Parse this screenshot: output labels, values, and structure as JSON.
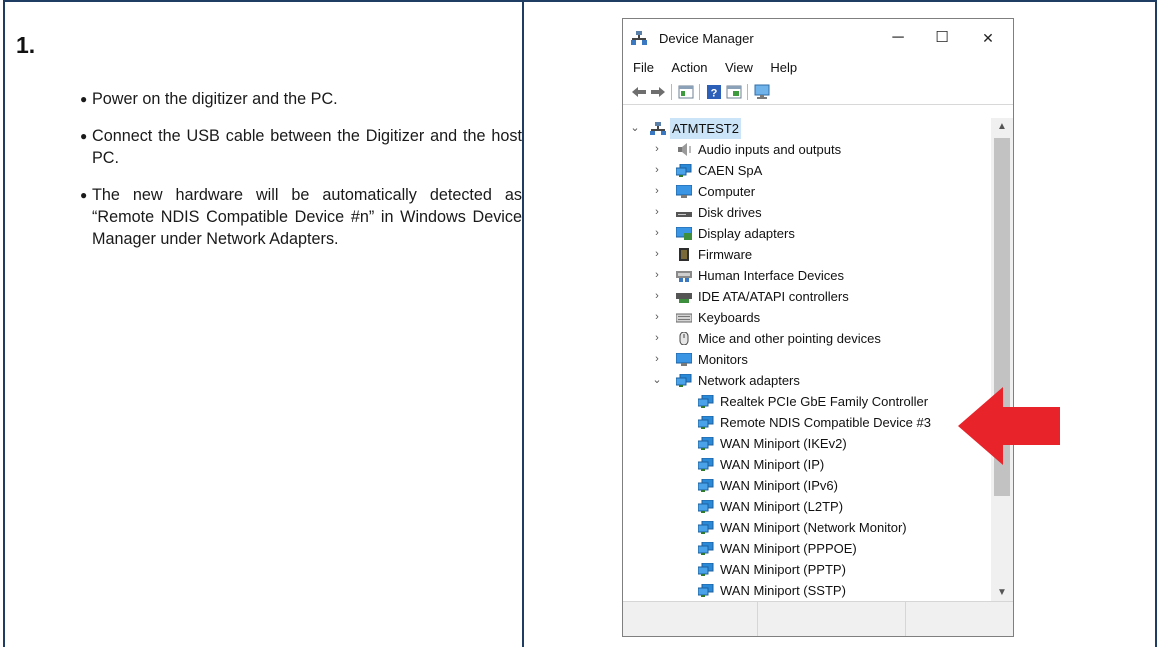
{
  "step": {
    "number": "1."
  },
  "instructions": [
    "Power on the digitizer and the PC.",
    "Connect the USB cable between the Digitizer and the host PC.",
    "The new hardware will be automatically detected as “Remote NDIS Compatible Device #n” in Windows Device Manager under Network Adapters."
  ],
  "window": {
    "title": "Device Manager",
    "controls": {
      "minimize": "─",
      "maximize": "☐",
      "close": "✕"
    },
    "menu": [
      "File",
      "Action",
      "View",
      "Help"
    ],
    "toolbar_icons": [
      "back-arrow-icon",
      "forward-arrow-icon",
      "properties-icon",
      "help-icon",
      "update-driver-icon",
      "scan-hardware-icon"
    ],
    "tree": {
      "root": "ATMTEST2",
      "categories": [
        {
          "label": "Audio inputs and outputs",
          "icon": "speaker-icon",
          "expanded": false
        },
        {
          "label": "CAEN SpA",
          "icon": "network-adapter-icon",
          "expanded": false
        },
        {
          "label": "Computer",
          "icon": "computer-icon",
          "expanded": false
        },
        {
          "label": "Disk drives",
          "icon": "disk-drive-icon",
          "expanded": false
        },
        {
          "label": "Display adapters",
          "icon": "display-adapter-icon",
          "expanded": false
        },
        {
          "label": "Firmware",
          "icon": "firmware-icon",
          "expanded": false
        },
        {
          "label": "Human Interface Devices",
          "icon": "hid-icon",
          "expanded": false
        },
        {
          "label": "IDE ATA/ATAPI controllers",
          "icon": "ide-controller-icon",
          "expanded": false
        },
        {
          "label": "Keyboards",
          "icon": "keyboard-icon",
          "expanded": false
        },
        {
          "label": "Mice and other pointing devices",
          "icon": "mouse-icon",
          "expanded": false
        },
        {
          "label": "Monitors",
          "icon": "monitor-icon",
          "expanded": false
        },
        {
          "label": "Network adapters",
          "icon": "network-adapter-icon",
          "expanded": true
        }
      ],
      "network_devices": [
        "Realtek PCIe GbE Family Controller",
        "Remote NDIS Compatible Device #3",
        "WAN Miniport (IKEv2)",
        "WAN Miniport (IP)",
        "WAN Miniport (IPv6)",
        "WAN Miniport (L2TP)",
        "WAN Miniport (Network Monitor)",
        "WAN Miniport (PPPOE)",
        "WAN Miniport (PPTP)",
        "WAN Miniport (SSTP)"
      ]
    }
  },
  "colors": {
    "frame": "#1f3d63",
    "arrow": "#e8232a",
    "selection": "#cce4f7",
    "icon_blue": "#2b7fd6"
  },
  "highlight": {
    "target": "Remote NDIS Compatible Device #3",
    "icon": "red-arrow-icon"
  }
}
